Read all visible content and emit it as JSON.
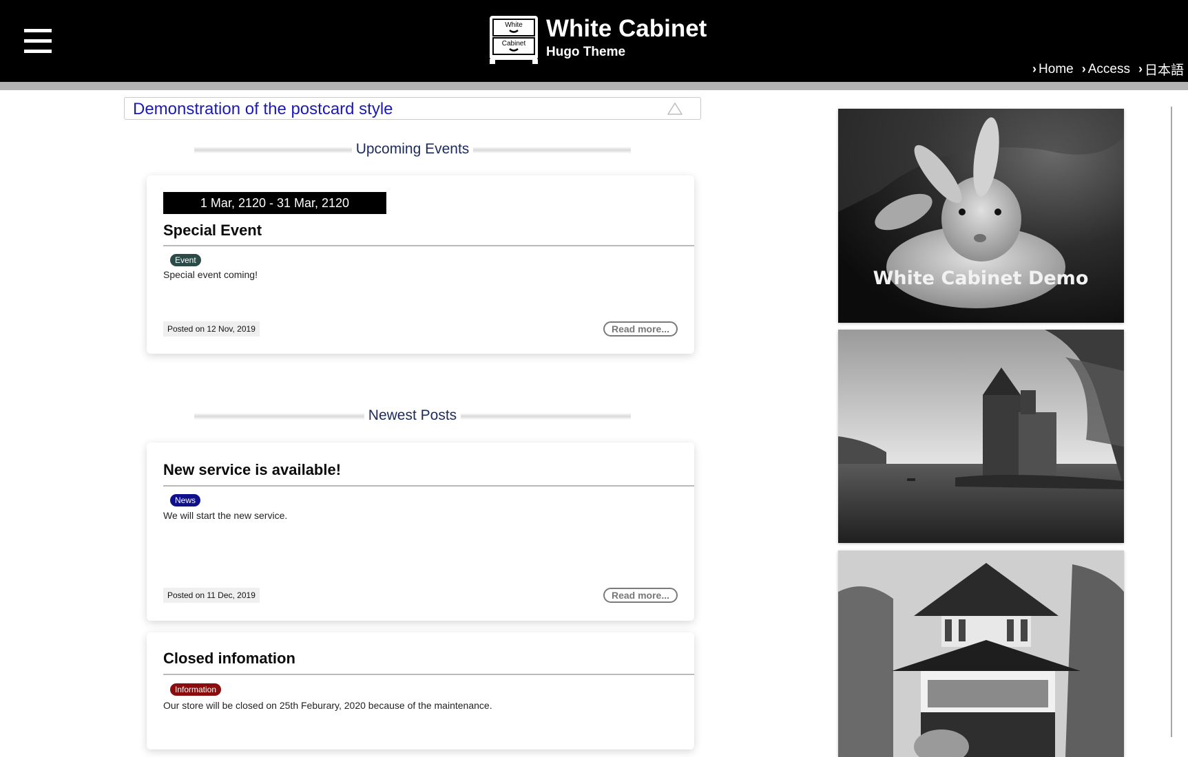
{
  "header": {
    "logo_top_text": "White",
    "logo_bottom_text": "Cabinet",
    "title": "White Cabinet",
    "subtitle": "Hugo Theme",
    "nav": [
      {
        "label": "Home"
      },
      {
        "label": "Access"
      },
      {
        "label": "日本語"
      }
    ]
  },
  "demo_bar": {
    "text": "Demonstration of the postcard style"
  },
  "upcoming": {
    "heading": "Upcoming Events",
    "cards": [
      {
        "date_range": "1 Mar, 2120 - 31 Mar, 2120",
        "title": "Special Event",
        "tag": "Event",
        "tag_color": "#2c4a48",
        "description": "Special event coming!",
        "posted": "Posted on 12 Nov, 2019",
        "read_more": "Read more..."
      }
    ]
  },
  "newest": {
    "heading": "Newest Posts",
    "cards": [
      {
        "title": "New service is available!",
        "tag": "News",
        "tag_color": "#10108c",
        "description": "We will start the new service.",
        "posted": "Posted on 11 Dec, 2019",
        "read_more": "Read more..."
      },
      {
        "title": "Closed infomation",
        "tag": "Information",
        "tag_color": "#8b0c0c",
        "description": "Our store will be closed on 25th Feburary, 2020 because of the maintenance."
      }
    ]
  },
  "sidebar": {
    "images": [
      {
        "caption": "White Cabinet Demo",
        "subject": "rabbit"
      },
      {
        "subject": "lake-castle"
      },
      {
        "subject": "japanese-pavilion"
      }
    ]
  }
}
